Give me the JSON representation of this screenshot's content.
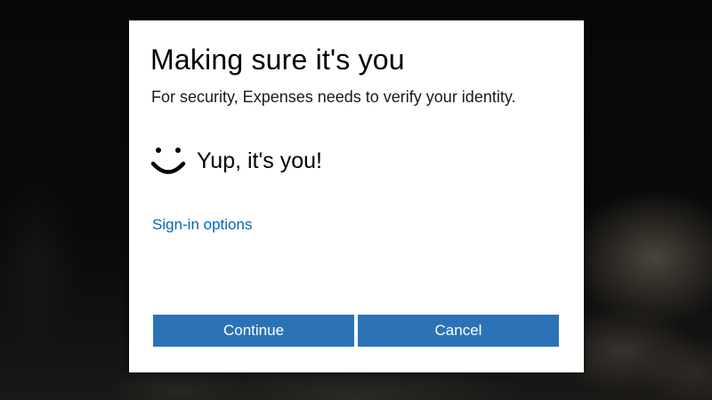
{
  "dialog": {
    "title": "Making sure it's you",
    "subtitle": "For security, Expenses needs to verify your identity.",
    "status_icon": "smile-icon",
    "status_text": "Yup, it's you!",
    "signin_link": "Sign-in options",
    "continue_label": "Continue",
    "cancel_label": "Cancel"
  },
  "colors": {
    "button": "#2b73b6",
    "link": "#0067b8",
    "dialog_background": "#ffffff"
  }
}
